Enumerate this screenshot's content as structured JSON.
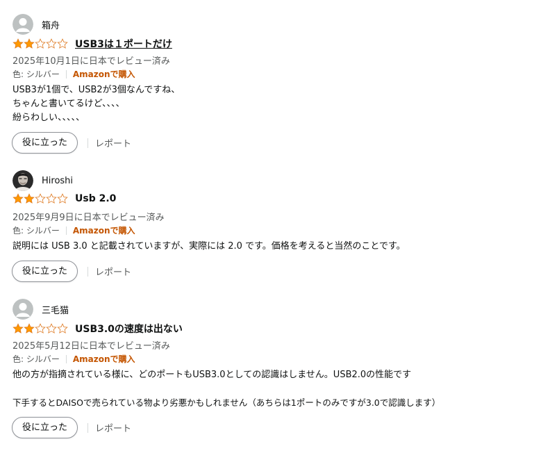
{
  "reviews": [
    {
      "author": "箱舟",
      "avatar": "default",
      "rating": 2,
      "max_rating": 5,
      "title": "USB3は１ポートだけ",
      "title_is_link": true,
      "date": "2025年10月1日に日本でレビュー済み",
      "color_label": "色: シルバー",
      "verified": "Amazonで購入",
      "body": [
        "USB3が1個で、USB2が3個なんですね、",
        "ちゃんと書いてるけど、、、、",
        "紛らわしい、、、、、"
      ],
      "helpful_label": "役に立った",
      "report_label": "レポート"
    },
    {
      "author": "Hiroshi",
      "avatar": "photo",
      "rating": 2,
      "max_rating": 5,
      "title": "Usb 2.0",
      "title_is_link": false,
      "date": "2025年9月9日に日本でレビュー済み",
      "color_label": "色: シルバー",
      "verified": "Amazonで購入",
      "body": [
        "説明には USB 3.0 と記載されていますが、実際には 2.0 です。価格を考えると当然のことです。"
      ],
      "helpful_label": "役に立った",
      "report_label": "レポート"
    },
    {
      "author": "三毛猫",
      "avatar": "default",
      "rating": 2,
      "max_rating": 5,
      "title": "USB3.0の速度は出ない",
      "title_is_link": false,
      "date": "2025年5月12日に日本でレビュー済み",
      "color_label": "色: シルバー",
      "verified": "Amazonで購入",
      "body": [
        "他の方が指摘されている様に、どのポートもUSB3.0としての認識はしません。USB2.0の性能です",
        "",
        "下手するとDAISOで売られている物より劣悪かもしれません（あちらは1ポートのみですが3.0で認識します）"
      ],
      "helpful_label": "役に立った",
      "report_label": "レポート"
    }
  ],
  "colors": {
    "star": "#ff9900",
    "star_outline": "#de7921",
    "verified": "#c45500",
    "muted": "#565959"
  }
}
